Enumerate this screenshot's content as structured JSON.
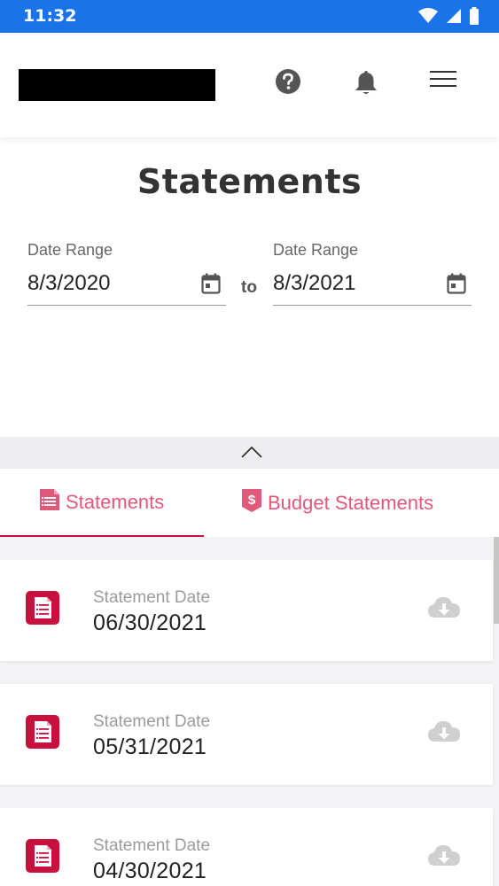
{
  "status_bar": {
    "time": "11:32"
  },
  "header": {
    "icons": [
      "help-icon",
      "bell-icon",
      "menu-icon"
    ]
  },
  "page": {
    "title": "Statements"
  },
  "date_range": {
    "from_label": "Date Range",
    "from_value": "8/3/2020",
    "separator": "to",
    "to_label": "Date Range",
    "to_value": "8/3/2021"
  },
  "tabs": [
    {
      "label": "Statements",
      "icon": "statement-icon",
      "active": true
    },
    {
      "label": "Budget Statements",
      "icon": "budget-icon",
      "active": false
    }
  ],
  "statements": [
    {
      "label": "Statement Date",
      "date": "06/30/2021"
    },
    {
      "label": "Statement Date",
      "date": "05/31/2021"
    },
    {
      "label": "Statement Date",
      "date": "04/30/2021"
    }
  ],
  "colors": {
    "status_bar": "#1a73e8",
    "accent": "#c8103e",
    "tab_text": "#e0587a",
    "download_icon": "#cfcfcf"
  }
}
